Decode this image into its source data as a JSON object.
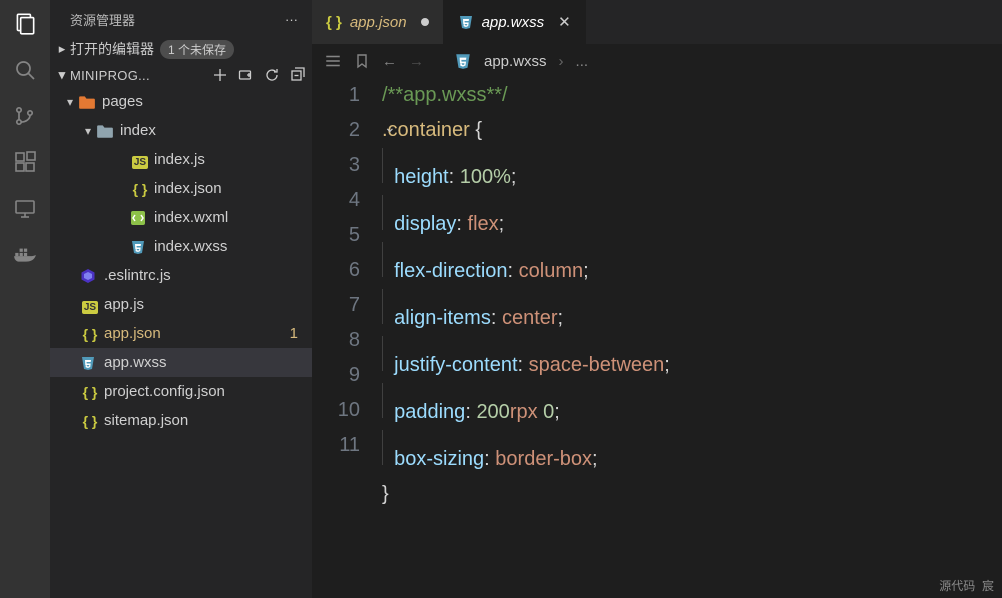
{
  "activitybar": {
    "items": [
      "explorer",
      "search",
      "source-control",
      "run-debug",
      "extensions",
      "docker"
    ]
  },
  "sidebar": {
    "title": "资源管理器",
    "open_editors": {
      "label": "打开的编辑器",
      "badge": "1 个未保存",
      "expanded": false
    },
    "project": {
      "label": "MINIPROG...",
      "expanded": true
    },
    "tree": [
      {
        "kind": "folder",
        "depth": 0,
        "label": "pages",
        "icon": "folder-pages",
        "expanded": true
      },
      {
        "kind": "folder",
        "depth": 1,
        "label": "index",
        "icon": "folder",
        "expanded": true
      },
      {
        "kind": "file",
        "depth": 2,
        "label": "index.js",
        "icon": "js"
      },
      {
        "kind": "file",
        "depth": 2,
        "label": "index.json",
        "icon": "json"
      },
      {
        "kind": "file",
        "depth": 2,
        "label": "index.wxml",
        "icon": "wxml"
      },
      {
        "kind": "file",
        "depth": 2,
        "label": "index.wxss",
        "icon": "wxss"
      },
      {
        "kind": "file",
        "depth": 0,
        "label": ".eslintrc.js",
        "icon": "eslint",
        "noTwisty": true
      },
      {
        "kind": "file",
        "depth": 0,
        "label": "app.js",
        "icon": "js",
        "noTwisty": true
      },
      {
        "kind": "file",
        "depth": 0,
        "label": "app.json",
        "icon": "json",
        "noTwisty": true,
        "modified": true,
        "modflag": "1"
      },
      {
        "kind": "file",
        "depth": 0,
        "label": "app.wxss",
        "icon": "wxss",
        "noTwisty": true,
        "active": true
      },
      {
        "kind": "file",
        "depth": 0,
        "label": "project.config.json",
        "icon": "json",
        "noTwisty": true
      },
      {
        "kind": "file",
        "depth": 0,
        "label": "sitemap.json",
        "icon": "json",
        "noTwisty": true
      }
    ]
  },
  "tabs": [
    {
      "label": "app.json",
      "icon": "json",
      "modified": true,
      "active": false
    },
    {
      "label": "app.wxss",
      "icon": "wxss",
      "modified": false,
      "active": true
    }
  ],
  "breadcrumb": {
    "file": "app.wxss",
    "trail": "..."
  },
  "editor": {
    "lines": [
      {
        "n": 1,
        "segs": [
          {
            "t": "/**app.wxss**/",
            "c": "c-cmt"
          }
        ]
      },
      {
        "n": 2,
        "fold": true,
        "segs": [
          {
            "t": ".container",
            "c": "c-sel"
          },
          {
            "t": " {",
            "c": "c-brace"
          }
        ]
      },
      {
        "n": 3,
        "indent": 1,
        "segs": [
          {
            "t": "height",
            "c": "c-prop"
          },
          {
            "t": ": ",
            "c": "c-colon"
          },
          {
            "t": "100%",
            "c": "c-num"
          },
          {
            "t": ";",
            "c": "c-colon"
          }
        ]
      },
      {
        "n": 4,
        "indent": 1,
        "segs": [
          {
            "t": "display",
            "c": "c-prop"
          },
          {
            "t": ": ",
            "c": "c-colon"
          },
          {
            "t": "flex",
            "c": "c-val"
          },
          {
            "t": ";",
            "c": "c-colon"
          }
        ]
      },
      {
        "n": 5,
        "indent": 1,
        "segs": [
          {
            "t": "flex-direction",
            "c": "c-prop"
          },
          {
            "t": ": ",
            "c": "c-colon"
          },
          {
            "t": "column",
            "c": "c-val"
          },
          {
            "t": ";",
            "c": "c-colon"
          }
        ]
      },
      {
        "n": 6,
        "indent": 1,
        "segs": [
          {
            "t": "align-items",
            "c": "c-prop"
          },
          {
            "t": ": ",
            "c": "c-colon"
          },
          {
            "t": "center",
            "c": "c-val"
          },
          {
            "t": ";",
            "c": "c-colon"
          }
        ]
      },
      {
        "n": 7,
        "indent": 1,
        "segs": [
          {
            "t": "justify-content",
            "c": "c-prop"
          },
          {
            "t": ": ",
            "c": "c-colon"
          },
          {
            "t": "space-between",
            "c": "c-val"
          },
          {
            "t": ";",
            "c": "c-colon"
          }
        ]
      },
      {
        "n": 8,
        "indent": 1,
        "segs": [
          {
            "t": "padding",
            "c": "c-prop"
          },
          {
            "t": ": ",
            "c": "c-colon"
          },
          {
            "t": "200",
            "c": "c-num"
          },
          {
            "t": "rpx ",
            "c": "c-val"
          },
          {
            "t": "0",
            "c": "c-num"
          },
          {
            "t": ";",
            "c": "c-colon"
          }
        ]
      },
      {
        "n": 9,
        "indent": 1,
        "segs": [
          {
            "t": "box-sizing",
            "c": "c-prop"
          },
          {
            "t": ": ",
            "c": "c-colon"
          },
          {
            "t": "border-box",
            "c": "c-val"
          },
          {
            "t": ";",
            "c": "c-colon"
          }
        ]
      },
      {
        "n": 10,
        "segs": [
          {
            "t": "}",
            "c": "c-brace"
          }
        ]
      },
      {
        "n": 11,
        "segs": []
      }
    ]
  },
  "status": {
    "left": "源代码",
    "right": "宸"
  }
}
